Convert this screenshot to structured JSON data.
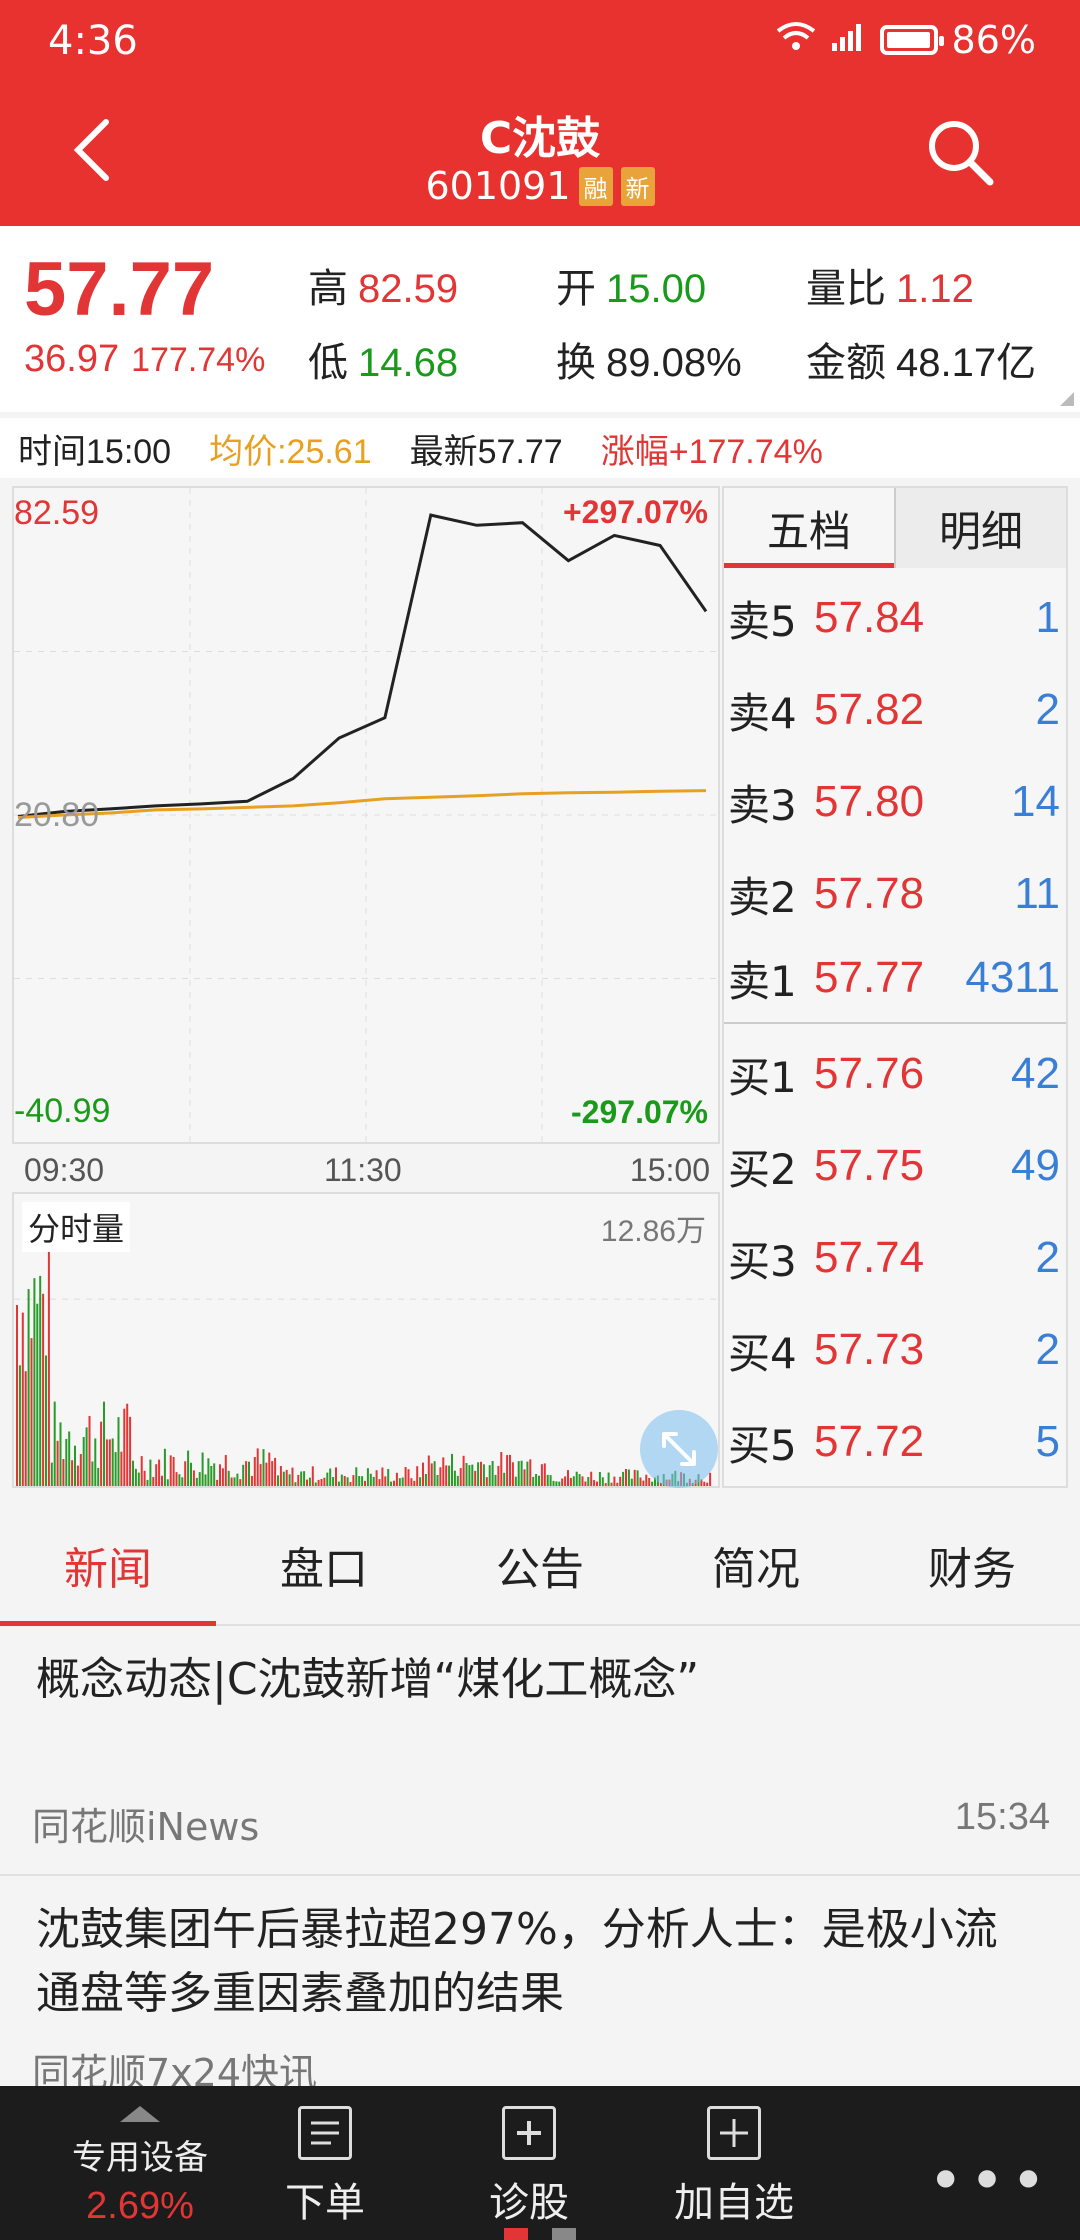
{
  "status": {
    "time": "4:36",
    "battery": "86%",
    "network": "4G"
  },
  "header": {
    "title": "C沈鼓",
    "code": "601091",
    "tags": [
      "融",
      "新"
    ]
  },
  "quote": {
    "price": "57.77",
    "change": "36.97",
    "change_pct": "177.74%",
    "high_label": "高",
    "high": "82.59",
    "low_label": "低",
    "low": "14.68",
    "open_label": "开",
    "open": "15.00",
    "turnover_label": "换",
    "turnover": "89.08%",
    "vol_ratio_label": "量比",
    "vol_ratio": "1.12",
    "amount_label": "金额",
    "amount": "48.17亿"
  },
  "info": {
    "time": "时间15:00",
    "avg": "均价:25.61",
    "latest": "最新57.77",
    "rise": "涨幅+177.74%"
  },
  "chart_labels": {
    "top_price": "82.59",
    "top_pct": "+297.07%",
    "mid_price": "20.80",
    "bottom_price": "-40.99",
    "bottom_pct": "-297.07%",
    "time_start": "09:30",
    "time_mid": "11:30",
    "time_end": "15:00",
    "volume_title": "分时量",
    "volume_max": "12.86万"
  },
  "chart_data": {
    "type": "line",
    "ylim": [
      -40.99,
      82.59
    ],
    "x": [
      "09:30",
      "10:00",
      "10:30",
      "11:00",
      "11:30",
      "13:00",
      "13:20",
      "13:40",
      "14:00",
      "14:05",
      "14:10",
      "14:20",
      "14:30",
      "14:40",
      "14:50",
      "15:00"
    ],
    "series": [
      {
        "values": [
          20.5,
          21.5,
          22.0,
          22.6,
          23.0,
          23.5,
          28.0,
          36.0,
          40.0,
          80.0,
          78.0,
          78.5,
          71.0,
          76.0,
          74.0,
          61.0
        ]
      },
      {
        "values": [
          20.3,
          20.8,
          21.2,
          21.8,
          22.0,
          22.3,
          22.6,
          23.2,
          24.0,
          24.3,
          24.6,
          25.0,
          25.2,
          25.3,
          25.5,
          25.61
        ]
      }
    ]
  },
  "order_book": {
    "tabs": [
      "五档",
      "明细"
    ],
    "sell": [
      {
        "label": "卖5",
        "price": "57.84",
        "vol": "1"
      },
      {
        "label": "卖4",
        "price": "57.82",
        "vol": "2"
      },
      {
        "label": "卖3",
        "price": "57.80",
        "vol": "14"
      },
      {
        "label": "卖2",
        "price": "57.78",
        "vol": "11"
      },
      {
        "label": "卖1",
        "price": "57.77",
        "vol": "4311"
      }
    ],
    "buy": [
      {
        "label": "买1",
        "price": "57.76",
        "vol": "42"
      },
      {
        "label": "买2",
        "price": "57.75",
        "vol": "49"
      },
      {
        "label": "买3",
        "price": "57.74",
        "vol": "2"
      },
      {
        "label": "买4",
        "price": "57.73",
        "vol": "2"
      },
      {
        "label": "买5",
        "price": "57.72",
        "vol": "5"
      }
    ]
  },
  "news_tabs": [
    "新闻",
    "盘口",
    "公告",
    "简况",
    "财务"
  ],
  "news": [
    {
      "title": "概念动态|C沈鼓新增“煤化工概念”",
      "source": "同花顺iNews",
      "time": "15:34"
    },
    {
      "title": "沈鼓集团午后暴拉超297%，分析人士：是极小流通盘等多重因素叠加的结果",
      "source": "同花顺7x24快讯",
      "time": ""
    }
  ],
  "bottom_bar": {
    "device_label": "专用设备",
    "device_value": "2.69%",
    "order": "下单",
    "diagnose": "诊股",
    "add": "加自选"
  }
}
